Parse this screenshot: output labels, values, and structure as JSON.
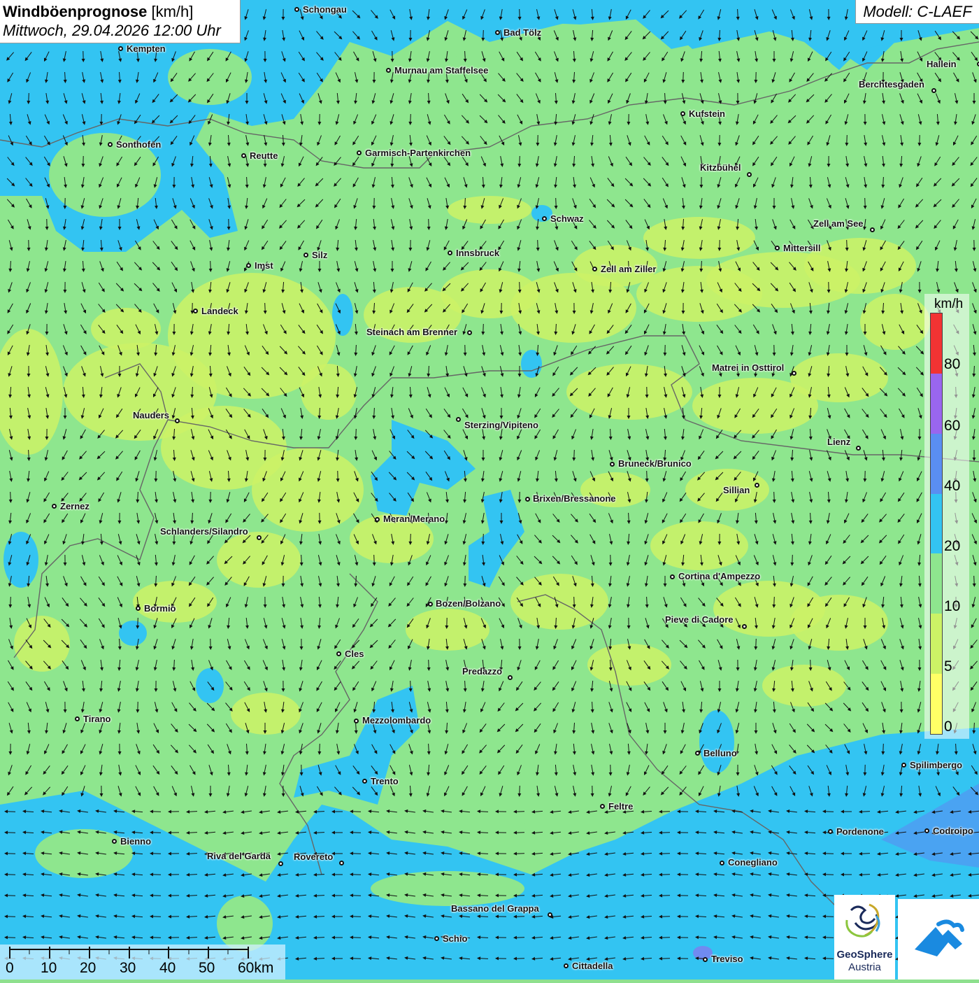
{
  "title": {
    "main": "Windböenprognose",
    "unit": "[km/h]",
    "datetime": "Mittwoch, 29.04.2026 12:00 Uhr"
  },
  "model": "Modell: C-LAEF",
  "legend": {
    "unit": "km/h",
    "levels": [
      {
        "label": "0",
        "color": "#ffff66"
      },
      {
        "label": "5",
        "color": "#ccf266"
      },
      {
        "label": "10",
        "color": "#8ee68e"
      },
      {
        "label": "20",
        "color": "#33c4f2"
      },
      {
        "label": "40",
        "color": "#5a8ef2"
      },
      {
        "label": "60",
        "color": "#9966ee"
      },
      {
        "label": "80",
        "color": "#f23333"
      }
    ]
  },
  "scale_bar": {
    "labels": [
      "0",
      "10",
      "20",
      "30",
      "40",
      "50",
      "60km"
    ]
  },
  "logos": {
    "geosphere_line1": "GeoSphere",
    "geosphere_line2": "Austria"
  },
  "cities": [
    {
      "name": "Schongau"
    },
    {
      "name": "Kempten"
    },
    {
      "name": "Bad Tölz"
    },
    {
      "name": "Hallein"
    },
    {
      "name": "Murnau am Staffelsee"
    },
    {
      "name": "Berchtesgaden"
    },
    {
      "name": "Kufstein"
    },
    {
      "name": "Sonthofen"
    },
    {
      "name": "Reutte"
    },
    {
      "name": "Garmisch-Partenkirchen"
    },
    {
      "name": "Kitzbühel"
    },
    {
      "name": "Schwaz"
    },
    {
      "name": "Zell am See"
    },
    {
      "name": "Mittersill"
    },
    {
      "name": "Imst"
    },
    {
      "name": "Silz"
    },
    {
      "name": "Innsbruck"
    },
    {
      "name": "Zell am Ziller"
    },
    {
      "name": "Landeck"
    },
    {
      "name": "Steinach am Brenner"
    },
    {
      "name": "Matrei in Osttirol"
    },
    {
      "name": "Nauders"
    },
    {
      "name": "Sterzing/Vipiteno"
    },
    {
      "name": "Lienz"
    },
    {
      "name": "Bruneck/Brunico"
    },
    {
      "name": "Sillian"
    },
    {
      "name": "Zernez"
    },
    {
      "name": "Brixen/Bressanone"
    },
    {
      "name": "Meran/Merano"
    },
    {
      "name": "Schlanders/Silandro"
    },
    {
      "name": "Cortina d'Ampezzo"
    },
    {
      "name": "Bozen/Bolzano"
    },
    {
      "name": "Bormio"
    },
    {
      "name": "Pieve di Cadore"
    },
    {
      "name": "Cles"
    },
    {
      "name": "Predazzo"
    },
    {
      "name": "Tirano"
    },
    {
      "name": "Mezzolombardo"
    },
    {
      "name": "Belluno"
    },
    {
      "name": "Spilimbergo"
    },
    {
      "name": "Trento"
    },
    {
      "name": "Feltre"
    },
    {
      "name": "Bienno"
    },
    {
      "name": "Pordenone"
    },
    {
      "name": "Codroipo"
    },
    {
      "name": "Riva del Garda"
    },
    {
      "name": "Rovereto"
    },
    {
      "name": "Conegliano"
    },
    {
      "name": "Bassano del Grappa"
    },
    {
      "name": "Schio"
    },
    {
      "name": "Treviso"
    },
    {
      "name": "Cittadella"
    }
  ]
}
